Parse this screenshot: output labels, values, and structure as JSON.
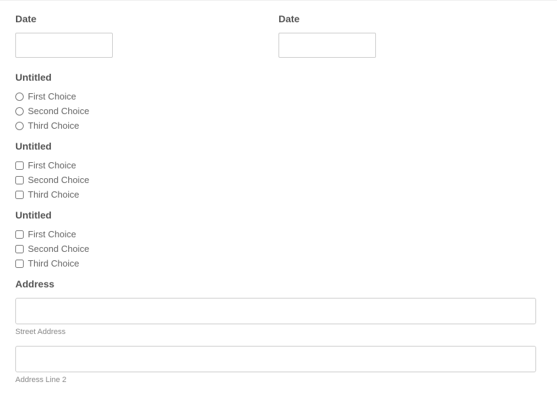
{
  "dateLeft": {
    "label": "Date",
    "value": ""
  },
  "dateRight": {
    "label": "Date",
    "value": ""
  },
  "radio1": {
    "label": "Untitled",
    "options": [
      "First Choice",
      "Second Choice",
      "Third Choice"
    ]
  },
  "check1": {
    "label": "Untitled",
    "options": [
      "First Choice",
      "Second Choice",
      "Third Choice"
    ]
  },
  "check2": {
    "label": "Untitled",
    "options": [
      "First Choice",
      "Second Choice",
      "Third Choice"
    ]
  },
  "address": {
    "label": "Address",
    "street": {
      "value": "",
      "sublabel": "Street Address"
    },
    "line2": {
      "value": "",
      "sublabel": "Address Line 2"
    }
  }
}
